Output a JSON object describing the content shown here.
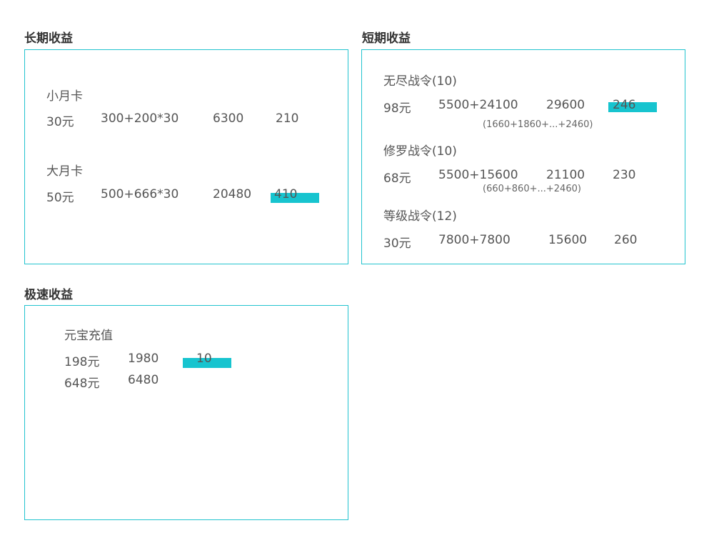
{
  "long_term": {
    "title": "长期收益",
    "small_card": {
      "name": "小月卡",
      "price": "30元",
      "formula": "300+200*30",
      "total": "6300",
      "ratio": "210"
    },
    "big_card": {
      "name": "大月卡",
      "price": "50元",
      "formula": "500+666*30",
      "total": "20480",
      "ratio": "410"
    }
  },
  "short_term": {
    "title": "短期收益",
    "endless_pass": {
      "name": "无尽战令(10)",
      "price": "98元",
      "formula": "5500+24100",
      "total": "29600",
      "ratio": "246",
      "note": "(1660+1860+...+2460)"
    },
    "shura_pass": {
      "name": "修罗战令(10)",
      "price": "68元",
      "formula": "5500+15600",
      "total": "21100",
      "ratio": "230",
      "note": "(660+860+...+2460)"
    },
    "level_pass": {
      "name": "等级战令(12)",
      "price": "30元",
      "formula": "7800+7800",
      "total": "15600",
      "ratio": "260"
    }
  },
  "fast": {
    "title": "极速收益",
    "topup": {
      "name": "元宝充值",
      "rows": [
        {
          "price": "198元",
          "amount": "1980",
          "ratio": "10"
        },
        {
          "price": "648元",
          "amount": "6480"
        }
      ]
    }
  },
  "colors": {
    "accent": "#17c4cf",
    "border": "#22c3cf"
  }
}
